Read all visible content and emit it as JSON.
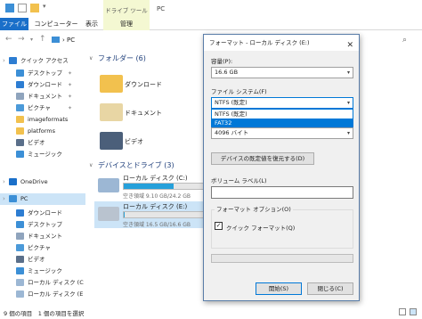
{
  "window": {
    "context_tab_header": "ドライブ ツール",
    "title": "PC"
  },
  "ribbon": {
    "tabs": [
      {
        "label": "ファイル"
      },
      {
        "label": "コンピューター"
      },
      {
        "label": "表示"
      },
      {
        "label": "管理"
      }
    ]
  },
  "address": {
    "path": "PC"
  },
  "nav": {
    "items": [
      {
        "label": "クイック アクセス",
        "icon": "star-icon",
        "color": "#2d7dd2",
        "pinned": false
      },
      {
        "label": "デスクトップ",
        "icon": "desktop-icon",
        "color": "#3c8fd6",
        "pinned": true
      },
      {
        "label": "ダウンロード",
        "icon": "download-icon",
        "color": "#2d7dd2",
        "pinned": true
      },
      {
        "label": "ドキュメント",
        "icon": "document-icon",
        "color": "#8fa4bd",
        "pinned": true
      },
      {
        "label": "ピクチャ",
        "icon": "pictures-icon",
        "color": "#4b9ad9",
        "pinned": true
      },
      {
        "label": "imageformats",
        "icon": "folder-icon",
        "color": "#f2c14e",
        "pinned": false
      },
      {
        "label": "platforms",
        "icon": "folder-icon",
        "color": "#f2c14e",
        "pinned": false
      },
      {
        "label": "ビデオ",
        "icon": "video-icon",
        "color": "#5a6f8a",
        "pinned": false
      },
      {
        "label": "ミュージック",
        "icon": "music-icon",
        "color": "#3c8fd6",
        "pinned": false
      },
      {
        "label": "OneDrive",
        "icon": "onedrive-icon",
        "color": "#1a6fc9",
        "pinned": false
      },
      {
        "label": "PC",
        "icon": "pc-icon",
        "color": "#3c8fd6",
        "pinned": false,
        "selected": true
      },
      {
        "label": "ダウンロード",
        "icon": "download-icon",
        "color": "#2d7dd2",
        "pinned": false
      },
      {
        "label": "デスクトップ",
        "icon": "desktop-icon",
        "color": "#3c8fd6",
        "pinned": false
      },
      {
        "label": "ドキュメント",
        "icon": "document-icon",
        "color": "#8fa4bd",
        "pinned": false
      },
      {
        "label": "ピクチャ",
        "icon": "pictures-icon",
        "color": "#4b9ad9",
        "pinned": false
      },
      {
        "label": "ビデオ",
        "icon": "video-icon",
        "color": "#5a6f8a",
        "pinned": false
      },
      {
        "label": "ミュージック",
        "icon": "music-icon",
        "color": "#3c8fd6",
        "pinned": false
      },
      {
        "label": "ローカル ディスク (C",
        "icon": "drive-icon",
        "color": "#9cb7d4",
        "pinned": false
      },
      {
        "label": "ローカル ディスク (E",
        "icon": "drive-icon",
        "color": "#9cb7d4",
        "pinned": false
      }
    ]
  },
  "content": {
    "folders_header": "フォルダー (6)",
    "folders": [
      {
        "label": "ダウンロード"
      },
      {
        "label": "ドキュメント"
      },
      {
        "label": "ビデオ"
      }
    ],
    "drives_header": "デバイスとドライブ (3)",
    "drives": [
      {
        "name": "ローカル ディスク (C:)",
        "status": "空き領域 9.10 GB/24.2 GB",
        "used_fraction": 0.62,
        "selected": false
      },
      {
        "name": "ローカル ディスク (E:)",
        "status": "空き領域 16.5 GB/16.6 GB",
        "used_fraction": 0.01,
        "selected": true
      }
    ]
  },
  "status_bar": {
    "text": "9 個の項目　1 個の項目を選択"
  },
  "dialog": {
    "title": "フォーマット - ローカル ディスク (E:)",
    "capacity_label": "容量(P):",
    "capacity_value": "16.6 GB",
    "fs_label": "ファイル システム(F)",
    "fs_value": "NTFS (既定)",
    "fs_options": [
      {
        "label": "NTFS (既定)",
        "highlighted": false
      },
      {
        "label": "FAT32",
        "highlighted": true
      }
    ],
    "alloc_value": "4096 バイト",
    "restore_button": "デバイスの既定値を復元する(D)",
    "volume_label": "ボリューム ラベル(L)",
    "volume_value": "",
    "format_options_label": "フォーマット オプション(O)",
    "quick_format_label": "クイック フォーマット(Q)",
    "quick_format_checked": true,
    "start_button": "開始(S)",
    "close_button": "閉じる(C)"
  }
}
